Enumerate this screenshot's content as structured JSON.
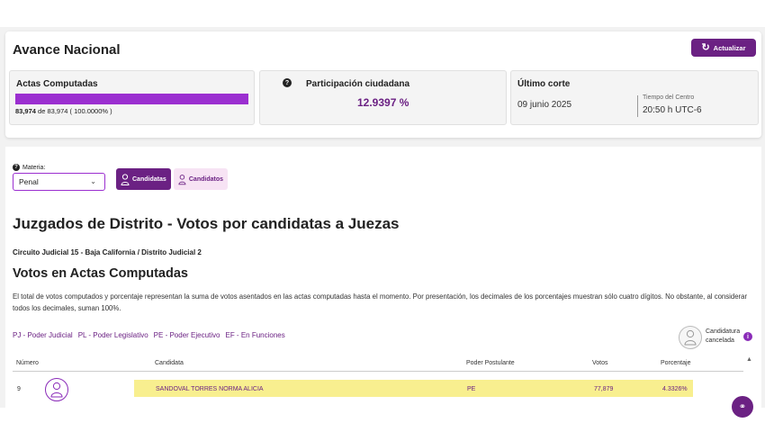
{
  "avance": {
    "title": "Avance Nacional",
    "refresh_label": "Actualizar",
    "actas": {
      "label": "Actas Computadas",
      "computed": "83,974",
      "of_text": "de",
      "total": "83,974",
      "percent_text": "( 100.0000% )",
      "progress_fraction": 1.0
    },
    "participacion": {
      "label": "Participación ciudadana",
      "value": "12.9397 %"
    },
    "corte": {
      "label": "Último corte",
      "date": "09 junio 2025",
      "tz_label": "Tiempo del Centro",
      "time": "20:50 h UTC-6"
    }
  },
  "filters": {
    "materia_label": "Materia:",
    "materia_value": "Penal",
    "toggle_candidatas": "Candidatas",
    "toggle_candidatos": "Candidatos"
  },
  "content": {
    "title": "Juzgados de Distrito - Votos por candidatas a Juezas",
    "breadcrumb": "Circuito Judicial 15 - Baja California  /  Distrito Judicial 2",
    "section_title": "Votos en Actas Computadas",
    "description": "El total de votos computados y porcentaje representan la suma de votos asentados en las actas computadas hasta el momento. Por presentación, los decimales de los porcentajes muestran sólo cuatro dígitos. No obstante, al considerar todos los decimales, suman 100%."
  },
  "legend": [
    "PJ - Poder Judicial",
    "PL - Poder Legislativo",
    "PE - Poder Ejecutivo",
    "EF - En Funciones"
  ],
  "cancelada_label_line1": "Candidatura",
  "cancelada_label_line2": "cancelada",
  "table": {
    "headers": {
      "numero": "Número",
      "candidata": "Candidata",
      "poder": "Poder Postulante",
      "votos": "Votos",
      "porcentaje": "Porcentaje"
    },
    "rows": [
      {
        "numero": "9",
        "candidata": "SANDOVAL TORRES NORMA ALICIA",
        "poder": "PE",
        "votos": "77,879",
        "porcentaje": "4.3326%"
      }
    ]
  },
  "colors": {
    "accent": "#6b2183",
    "progress": "#9b2fd0",
    "highlight": "#f8ef8f"
  },
  "icons": {
    "refresh": "refresh-icon",
    "help": "question-icon",
    "chevron": "chevron-down-icon",
    "person": "person-icon",
    "info": "info-icon",
    "share": "share-icon"
  }
}
